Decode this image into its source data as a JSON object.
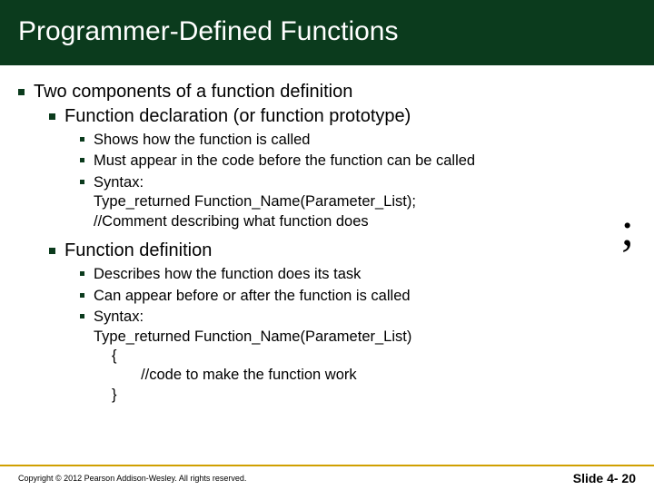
{
  "title": "Programmer-Defined Functions",
  "bullets": {
    "main": "Two components of a function definition",
    "decl": {
      "heading": "Function declaration (or function prototype)",
      "b1": "Shows how the function is called",
      "b2": "Must appear in the code before the function can be called",
      "b3l1": "Syntax:",
      "b3l2": "Type_returned  Function_Name(Parameter_List);",
      "b3l3": "//Comment describing what function does"
    },
    "def": {
      "heading": "Function definition",
      "b1": "Describes how the function does its task",
      "b2": "Can appear before or after the function is called",
      "b3l1": "Syntax:",
      "b3l2": "Type_returned  Function_Name(Parameter_List)",
      "b3l3": "{",
      "b3l4": "       //code to make the function work",
      "b3l5": "}"
    }
  },
  "annotation": ";",
  "footer": {
    "copyright": "Copyright © 2012 Pearson Addison-Wesley. All rights reserved.",
    "slidenum": "Slide 4- 20"
  }
}
